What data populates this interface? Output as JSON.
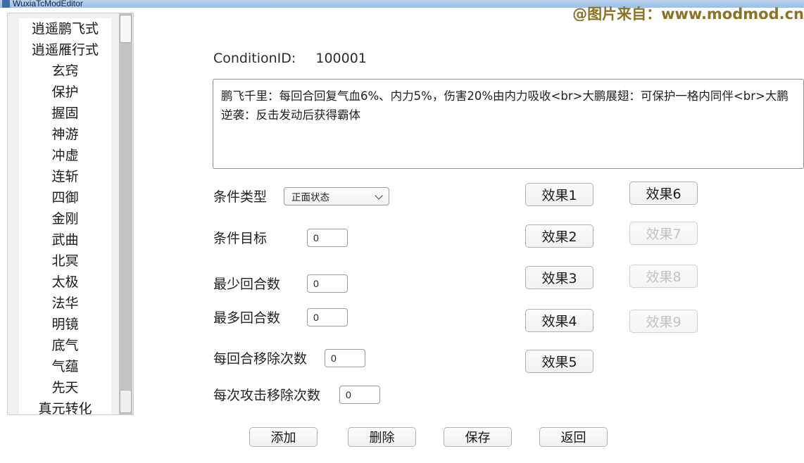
{
  "window": {
    "title": "WuxiaTcModEditor",
    "icon": "app-icon"
  },
  "watermark": {
    "text": "@图片来自：www.modmod.cn",
    "color": "#8a7324"
  },
  "sidebar": {
    "items": [
      {
        "label": "逍遥鹏飞式"
      },
      {
        "label": "逍遥雁行式"
      },
      {
        "label": "玄窍"
      },
      {
        "label": "保护"
      },
      {
        "label": "握固"
      },
      {
        "label": "神游"
      },
      {
        "label": "冲虚"
      },
      {
        "label": "连斩"
      },
      {
        "label": "四御"
      },
      {
        "label": "金刚"
      },
      {
        "label": "武曲"
      },
      {
        "label": "北冥"
      },
      {
        "label": "太极"
      },
      {
        "label": "法华"
      },
      {
        "label": "明镜"
      },
      {
        "label": "底气"
      },
      {
        "label": "气蕴"
      },
      {
        "label": "先天"
      },
      {
        "label": "真元转化"
      }
    ]
  },
  "main": {
    "condition_id_label": "ConditionID:",
    "condition_id_value": "100001",
    "description": "鹏飞千里：每回合回复气血6%、内力5%，伤害20%由内力吸收<br>大鹏展翅：可保护一格内同伴<br>大鹏逆袭：反击发动后获得霸体",
    "fields": {
      "condition_type": {
        "label": "条件类型",
        "value": "正面状态",
        "chevron": "chevron-down-icon"
      },
      "condition_target": {
        "label": "条件目标",
        "value": "0"
      },
      "min_rounds": {
        "label": "最少回合数",
        "value": "0"
      },
      "max_rounds": {
        "label": "最多回合数",
        "value": "0"
      },
      "remove_per_round": {
        "label": "每回合移除次数",
        "value": "0"
      },
      "remove_per_attack": {
        "label": "每次攻击移除次数",
        "value": "0"
      }
    },
    "effect_buttons": [
      {
        "label": "效果1",
        "disabled": false
      },
      {
        "label": "效果2",
        "disabled": false
      },
      {
        "label": "效果3",
        "disabled": false
      },
      {
        "label": "效果4",
        "disabled": false
      },
      {
        "label": "效果5",
        "disabled": false
      },
      {
        "label": "效果6",
        "disabled": false
      },
      {
        "label": "效果7",
        "disabled": true
      },
      {
        "label": "效果8",
        "disabled": true
      },
      {
        "label": "效果9",
        "disabled": true
      }
    ],
    "bottom_buttons": [
      {
        "label": "添加"
      },
      {
        "label": "删除"
      },
      {
        "label": "保存"
      },
      {
        "label": "返回"
      }
    ]
  }
}
